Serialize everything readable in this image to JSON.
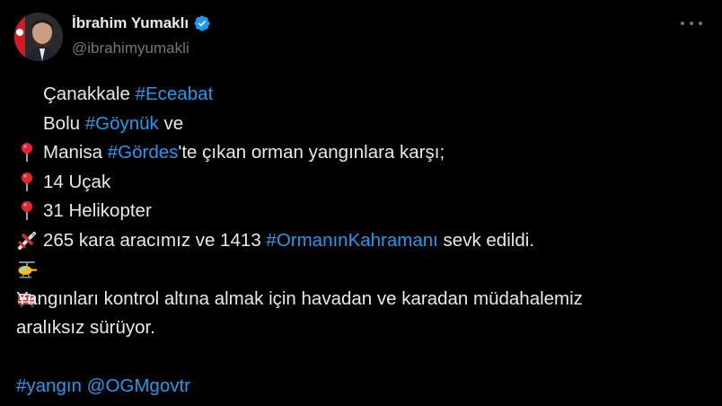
{
  "author": {
    "display_name": "İbrahim Yumaklı",
    "handle": "@ibrahimyumakli",
    "verified_icon": "verified-badge-icon",
    "verified_color": "#1d9bf0"
  },
  "menu": {
    "icon": "more-options-icon"
  },
  "tweet": {
    "line1": {
      "emoji": "round-pushpin-icon",
      "text_a": "Çanakkale ",
      "tag": "#Eceabat"
    },
    "line2": {
      "emoji": "round-pushpin-icon",
      "text_a": "Bolu ",
      "tag": "#Göynük",
      "text_b": " ve"
    },
    "line3": {
      "emoji": "round-pushpin-icon",
      "text_a": "Manisa ",
      "tag": "#Gördes",
      "text_b": "'te çıkan orman yangınlara karşı;"
    },
    "line4": {
      "emoji": "airplane-icon",
      "text_a": "14 Uçak"
    },
    "line5": {
      "emoji": "helicopter-icon",
      "text_a": "31 Helikopter"
    },
    "line6": {
      "emoji": "fire-engine-icon",
      "text_a": "265 kara aracımız ve 1413 ",
      "tag": "#OrmanınKahramanı",
      "text_b": " sevk edildi."
    },
    "para2_line1": "Yangınları kontrol altına almak için havadan ve karadan müdahalemiz",
    "para2_line2": "aralıksız sürüyor.",
    "footer_tag": "#yangın",
    "footer_mention": "@OGMgovtr"
  },
  "colors": {
    "background": "#000000",
    "text": "#e7e9ea",
    "secondary_text": "#71767b",
    "link": "#1d9bf0"
  }
}
